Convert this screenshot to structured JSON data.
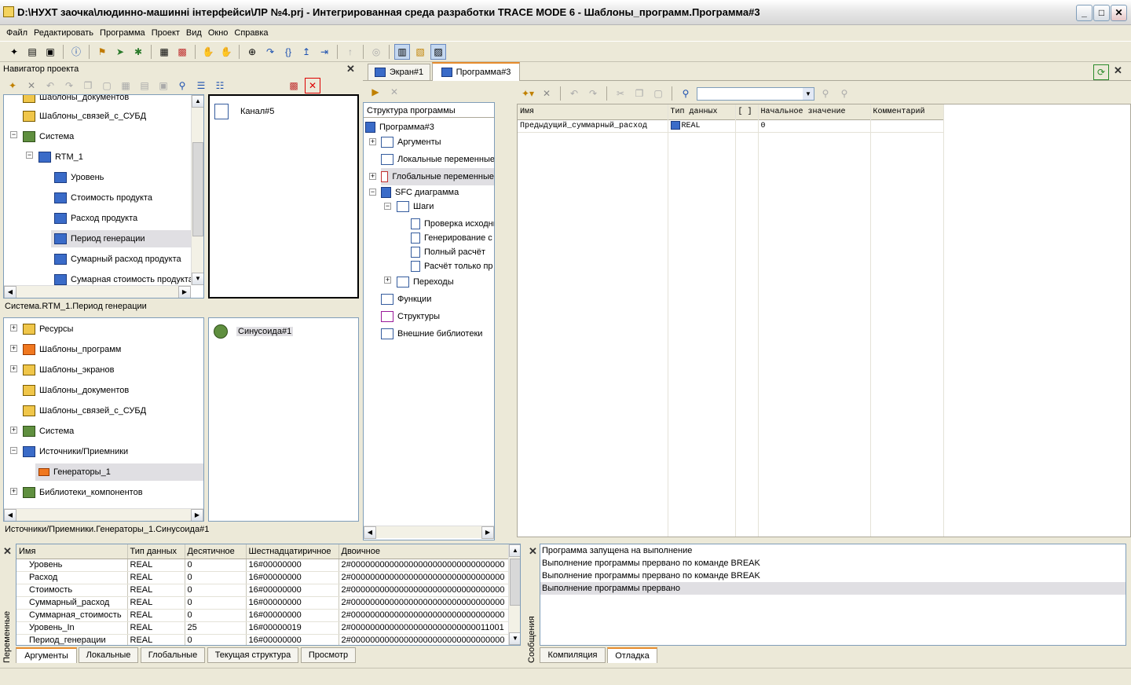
{
  "window": {
    "title": "D:\\НУХТ заочка\\людинно-машинні інтерфейси\\ЛР №4.prj - Интегрированная среда разработки TRACE MODE 6 - Шаблоны_программ.Программа#3",
    "minimize_label": "_",
    "maximize_label": "□",
    "close_label": "✕"
  },
  "menu": [
    "Файл",
    "Редактировать",
    "Программа",
    "Проект",
    "Вид",
    "Окно",
    "Справка"
  ],
  "navigator": {
    "title": "Навигатор проекта",
    "top_tree": [
      {
        "label": "Шаблоны_документов"
      },
      {
        "label": "Шаблоны_связей_с_СУБД"
      },
      {
        "label": "Система"
      },
      {
        "label": "RTM_1"
      },
      {
        "label": "Уровень"
      },
      {
        "label": "Стоимость продукта"
      },
      {
        "label": "Расход продукта"
      },
      {
        "label": "Период генерации"
      },
      {
        "label": "Сумарный расход продукта"
      },
      {
        "label": "Сумарная стоимость продукта"
      }
    ],
    "top_right_item": "Канал#5",
    "top_path": "Система.RTM_1.Период генерации",
    "bottom_tree": [
      {
        "label": "Ресурсы"
      },
      {
        "label": "Шаблоны_программ"
      },
      {
        "label": "Шаблоны_экранов"
      },
      {
        "label": "Шаблоны_документов"
      },
      {
        "label": "Шаблоны_связей_с_СУБД"
      },
      {
        "label": "Система"
      },
      {
        "label": "Источники/Приемники"
      },
      {
        "label": "Генераторы_1"
      },
      {
        "label": "Библиотеки_компонентов"
      }
    ],
    "bottom_right_item": "Синусоида#1",
    "bottom_path": "Источники/Приемники.Генераторы_1.Синусоида#1"
  },
  "editor_tabs": [
    {
      "label": "Экран#1"
    },
    {
      "label": "Программа#3"
    }
  ],
  "structure": {
    "title": "Структура программы",
    "items": [
      {
        "label": "Программа#3"
      },
      {
        "label": "Аргументы"
      },
      {
        "label": "Локальные переменные"
      },
      {
        "label": "Глобальные переменные"
      },
      {
        "label": "SFC диаграмма"
      },
      {
        "label": "Шаги"
      },
      {
        "label": "Проверка исходных"
      },
      {
        "label": "Генерирование с"
      },
      {
        "label": "Полный расчёт"
      },
      {
        "label": "Расчёт только пр"
      },
      {
        "label": "Переходы"
      },
      {
        "label": "Функции"
      },
      {
        "label": "Структуры"
      },
      {
        "label": "Внешние библиотеки"
      }
    ]
  },
  "args_table": {
    "headers": [
      "Имя",
      "Тип данных",
      "[ ]",
      "Начальное значение",
      "Комментарий"
    ],
    "rows": [
      [
        "Предыдущий_суммарный_расход",
        "REAL",
        "",
        "0",
        ""
      ]
    ]
  },
  "variables": {
    "side_label": "Переменные",
    "headers": [
      "Имя",
      "Тип данных",
      "Десятичное",
      "Шестнадцатиричное",
      "Двоичное"
    ],
    "rows": [
      [
        "Уровень",
        "REAL",
        "0",
        "16#00000000",
        "2#00000000000000000000000000000000"
      ],
      [
        "Расход",
        "REAL",
        "0",
        "16#00000000",
        "2#00000000000000000000000000000000"
      ],
      [
        "Стоимость",
        "REAL",
        "0",
        "16#00000000",
        "2#00000000000000000000000000000000"
      ],
      [
        "Суммарный_расход",
        "REAL",
        "0",
        "16#00000000",
        "2#00000000000000000000000000000000"
      ],
      [
        "Суммарная_стоимость",
        "REAL",
        "0",
        "16#00000000",
        "2#00000000000000000000000000000000"
      ],
      [
        "Уровень_In",
        "REAL",
        "25",
        "16#00000019",
        "2#00000000000000000000000000011001"
      ],
      [
        "Период_генерации",
        "REAL",
        "0",
        "16#00000000",
        "2#00000000000000000000000000000000"
      ]
    ],
    "tabs": [
      "Аргументы",
      "Локальные",
      "Глобальные",
      "Текущая структура",
      "Просмотр"
    ]
  },
  "messages": {
    "side_label": "Сообщения",
    "lines": [
      "Программа запущена на выполнение",
      "Выполнение программы прервано по команде BREAK",
      "Выполнение программы прервано по команде BREAK",
      "Выполнение программы прервано"
    ],
    "tabs": [
      "Компиляция",
      "Отладка"
    ]
  }
}
